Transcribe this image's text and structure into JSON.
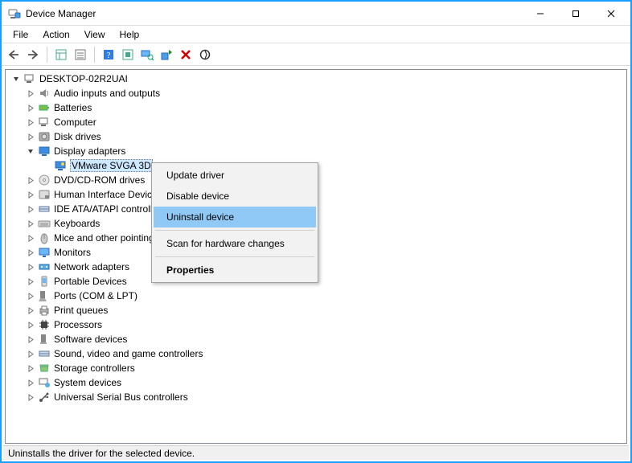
{
  "window": {
    "title": "Device Manager"
  },
  "menubar": [
    "File",
    "Action",
    "View",
    "Help"
  ],
  "tree": {
    "root": "DESKTOP-02R2UAI",
    "categories": [
      {
        "label": "Audio inputs and outputs",
        "expanded": false
      },
      {
        "label": "Batteries",
        "expanded": false
      },
      {
        "label": "Computer",
        "expanded": false
      },
      {
        "label": "Disk drives",
        "expanded": false
      },
      {
        "label": "Display adapters",
        "expanded": true,
        "children": [
          {
            "label": "VMware SVGA 3D",
            "selected": true
          }
        ]
      },
      {
        "label": "DVD/CD-ROM drives",
        "expanded": false
      },
      {
        "label": "Human Interface Devices",
        "expanded": false
      },
      {
        "label": "IDE ATA/ATAPI controllers",
        "expanded": false
      },
      {
        "label": "Keyboards",
        "expanded": false
      },
      {
        "label": "Mice and other pointing devices",
        "expanded": false
      },
      {
        "label": "Monitors",
        "expanded": false
      },
      {
        "label": "Network adapters",
        "expanded": false
      },
      {
        "label": "Portable Devices",
        "expanded": false
      },
      {
        "label": "Ports (COM & LPT)",
        "expanded": false
      },
      {
        "label": "Print queues",
        "expanded": false
      },
      {
        "label": "Processors",
        "expanded": false
      },
      {
        "label": "Software devices",
        "expanded": false
      },
      {
        "label": "Sound, video and game controllers",
        "expanded": false
      },
      {
        "label": "Storage controllers",
        "expanded": false
      },
      {
        "label": "System devices",
        "expanded": false
      },
      {
        "label": "Universal Serial Bus controllers",
        "expanded": false
      }
    ]
  },
  "context_menu": {
    "items": [
      {
        "label": "Update driver"
      },
      {
        "label": "Disable device"
      },
      {
        "label": "Uninstall device",
        "highlight": true
      },
      {
        "separator": true
      },
      {
        "label": "Scan for hardware changes"
      },
      {
        "separator": true
      },
      {
        "label": "Properties",
        "bold": true
      }
    ]
  },
  "statusbar": "Uninstalls the driver for the selected device."
}
